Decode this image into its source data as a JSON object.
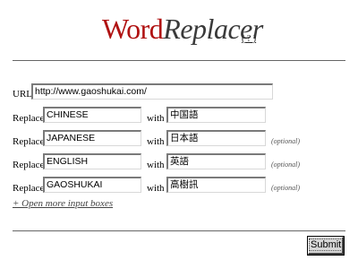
{
  "header": {
    "logo_word": "Word",
    "logo_replacer": "Replacer",
    "help_link": "( ? )"
  },
  "url": {
    "label": "URL:",
    "value": "http://www.gaoshukai.com/"
  },
  "rows": [
    {
      "replace_label": "Replace",
      "from": "CHINESE",
      "with_label": "with",
      "to": "中国語",
      "optional": ""
    },
    {
      "replace_label": "Replace",
      "from": "JAPANESE",
      "with_label": "with",
      "to": "日本語",
      "optional": "(optional)"
    },
    {
      "replace_label": "Replace",
      "from": "ENGLISH",
      "with_label": "with",
      "to": "英語",
      "optional": "(optional)"
    },
    {
      "replace_label": "Replace",
      "from": "GAOSHUKAI",
      "with_label": "with",
      "to": "高樹訊",
      "optional": "(optional)"
    }
  ],
  "more_link": "+ Open more input boxes",
  "submit_label": "Submit"
}
